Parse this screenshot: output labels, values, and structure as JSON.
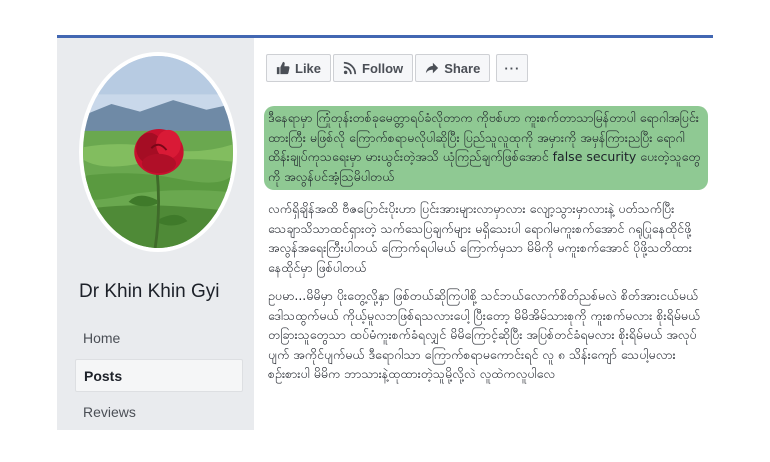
{
  "page": {
    "name": "Dr Khin Khin Gyi"
  },
  "nav": [
    {
      "label": "Home",
      "active": false
    },
    {
      "label": "Posts",
      "active": true
    },
    {
      "label": "Reviews",
      "active": false
    }
  ],
  "actions": {
    "like": "Like",
    "follow": "Follow",
    "share": "Share",
    "more": "···"
  },
  "post": {
    "highlighted_text": "ဒီနေရာမှာ ကြုံတုန်းတစ်ခုမေတ္တာရပ်ခံလိုတာက ကိုဗစ်ဟာ ကူးစက်တာသာမြန်တာပါ ရောဂါအပြင်းထားကြီး မဖြစ်လို ကြောက်စရာမလိုပါဆိုပြီး ပြည်သူလူထုကို အမှားကို အမှန်ကြားညပြီး ရောဂါထိန်းချုပ်ကုသရေးမှာ မားယွင်းတဲ့အသိ ယုံကြည်ချက်ဖြစ်အောင် false security ပေးတဲ့သူတွေကို အလွန်ပင်အံ့သြမိပါတယ်",
    "paragraph_1": "လက်ရှိချိန်အထိ ဗီဇပြောင်းပိုးဟာ ပြင်းအားများလာမှာလား လျော့သွားမှာလားနဲ့ ပတ်သက်ပြီး သေချာသိသာထင်ရှားတဲ့ သက်သေပြချက်များ မရှိသေးပါ ရောဂါမကူးစက်အောင် ဂရုပြုနေထိုင်ဖို့အလွန်အရေးကြီးပါတယ် ကြောက်ရပါမယ် ကြောက်မှသာ မိမိကို မကူးစက်အောင် ပိုဖို့သတိထား နေထိုင်မှာ ဖြစ်ပါတယ်",
    "paragraph_2": "ဥပမာ...မိမိမှာ ပိုးတွေ့လို့နှာ ဖြစ်တယ်ဆိုကြပါစို့ သင်ဘယ်လောက်စိတ်ညစ်မလဲ စိတ်အားငယ်မယ် ဒေါသထွက်မယ် ကိုယ့်မူလဘဖြစ်ရသလားပေါ့ ပြီးတော့ မိမိအိမ်သားစုကို ကူးစက်မလား စိုးရိမ်မယ် တခြားသူတွေသာ ထပ်မံကူးစက်ခံရလျှင် မိမိကြောင့်ဆိုပြီး အပြစ်တင်ခံရမလား စိုးရိမ်မယ် အလုပ်ပျက် အကိုင်ပျက်မယ် ဒီရောဂါသာ ကြောက်စရာမကောင်းရင် လူ ၈ သိန်းကျော် သေပါ့မလား စဉ်းစားပါ မိမိက ဘာသားနဲ့ထုထားတဲ့သူမို့လို့လဲ လူထဲကလူပါလေ"
  },
  "colors": {
    "highlight": "#8fc993",
    "frame_bg": "#e9ebee",
    "accent_border": "#4267b2"
  }
}
